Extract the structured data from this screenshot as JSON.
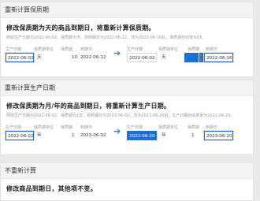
{
  "section1": {
    "header": "重新计算保质期",
    "title": "修改保质期为天的商品到期日，将重新计算保质期。",
    "note": "例如生产日期为2022-06-02，保质期为天，则到期日为2022-06-12，改为2022-06-16后，保质期自动变为15。",
    "left": {
      "labels": [
        "生产日期",
        "保质期单位",
        "保质期",
        "到期日"
      ],
      "production_date": "2022-06-02",
      "unit": "天",
      "shelf_life": "10",
      "expiry": "2022-06-12"
    },
    "right": {
      "labels": [
        "生产日期",
        "保质期单位",
        "保质期",
        "到期日"
      ],
      "production_date": "2022-06-02",
      "unit": "天",
      "shelf_life": "",
      "expiry": "2022-06-16"
    }
  },
  "section2": {
    "header": "重新计算生产日期",
    "title": "修改保质期为月/年的商品到期日，将重新计算生产日期。",
    "note": "例如生产日期为2022-06-02，保质期为1年，则到期日为2023-06-02，改为2023-06-20后，生产日期自动变更为2022-06-20。",
    "left": {
      "labels": [
        "生产日期",
        "保质期单位",
        "保质期",
        "到期日"
      ],
      "production_date": "2022-06-02",
      "unit": "年",
      "shelf_life": "1",
      "expiry": "2023-06-02"
    },
    "right": {
      "labels": [
        "生产日期",
        "保质期单位",
        "保质期",
        "到期日"
      ],
      "production_date": "2022-06-20",
      "unit": "年",
      "shelf_life": "1",
      "expiry": "2023-06-20"
    }
  },
  "section3": {
    "header": "不重新计算",
    "title": "修改商品到期日，其他项不变。"
  },
  "arrow_glyph": "➔"
}
